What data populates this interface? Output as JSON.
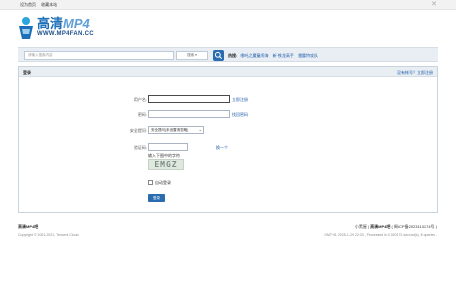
{
  "topbar": {
    "set_home": "设为首页",
    "bookmark": "收藏本站",
    "close_glyph": "✕"
  },
  "logo": {
    "brand_main": "高清",
    "brand_mp4": "MP4",
    "url": "WWW.MP4FAN.CC"
  },
  "search": {
    "placeholder": "请输入搜索内容",
    "type_label": "搜索",
    "hot_label": "热搜:",
    "hot_words": [
      "哪吒之魔童闹海",
      "新·铁龙高手",
      "雷霆特攻队"
    ]
  },
  "panel": {
    "title": "登录",
    "register_link": "没有帐号？立即注册"
  },
  "form": {
    "username_label": "用户名:",
    "username_link": "立即注册",
    "password_label": "密码:",
    "password_link": "找回密码",
    "question_label": "安全提问:",
    "question_value": "安全提问(未设置请忽略)",
    "captcha_label": "验证码:",
    "captcha_refresh": "换一个",
    "captcha_hint": "输入下图中的字符",
    "captcha_text": "EMGZ",
    "auto_login": "自动登录",
    "login_button": "登录"
  },
  "footer": {
    "site_name": "高清MP4吧",
    "copyright": "Copyright © 2001-2021, Tencent Cloud.",
    "right_links": "小黑屋",
    "right_site": "高清MP4吧",
    "icp": "( 闽ICP备2023113174号 )",
    "stats": "GMT+8, 2025-1-29 22:33 , Processed in 0.020172 second(s), 8 queries ."
  }
}
